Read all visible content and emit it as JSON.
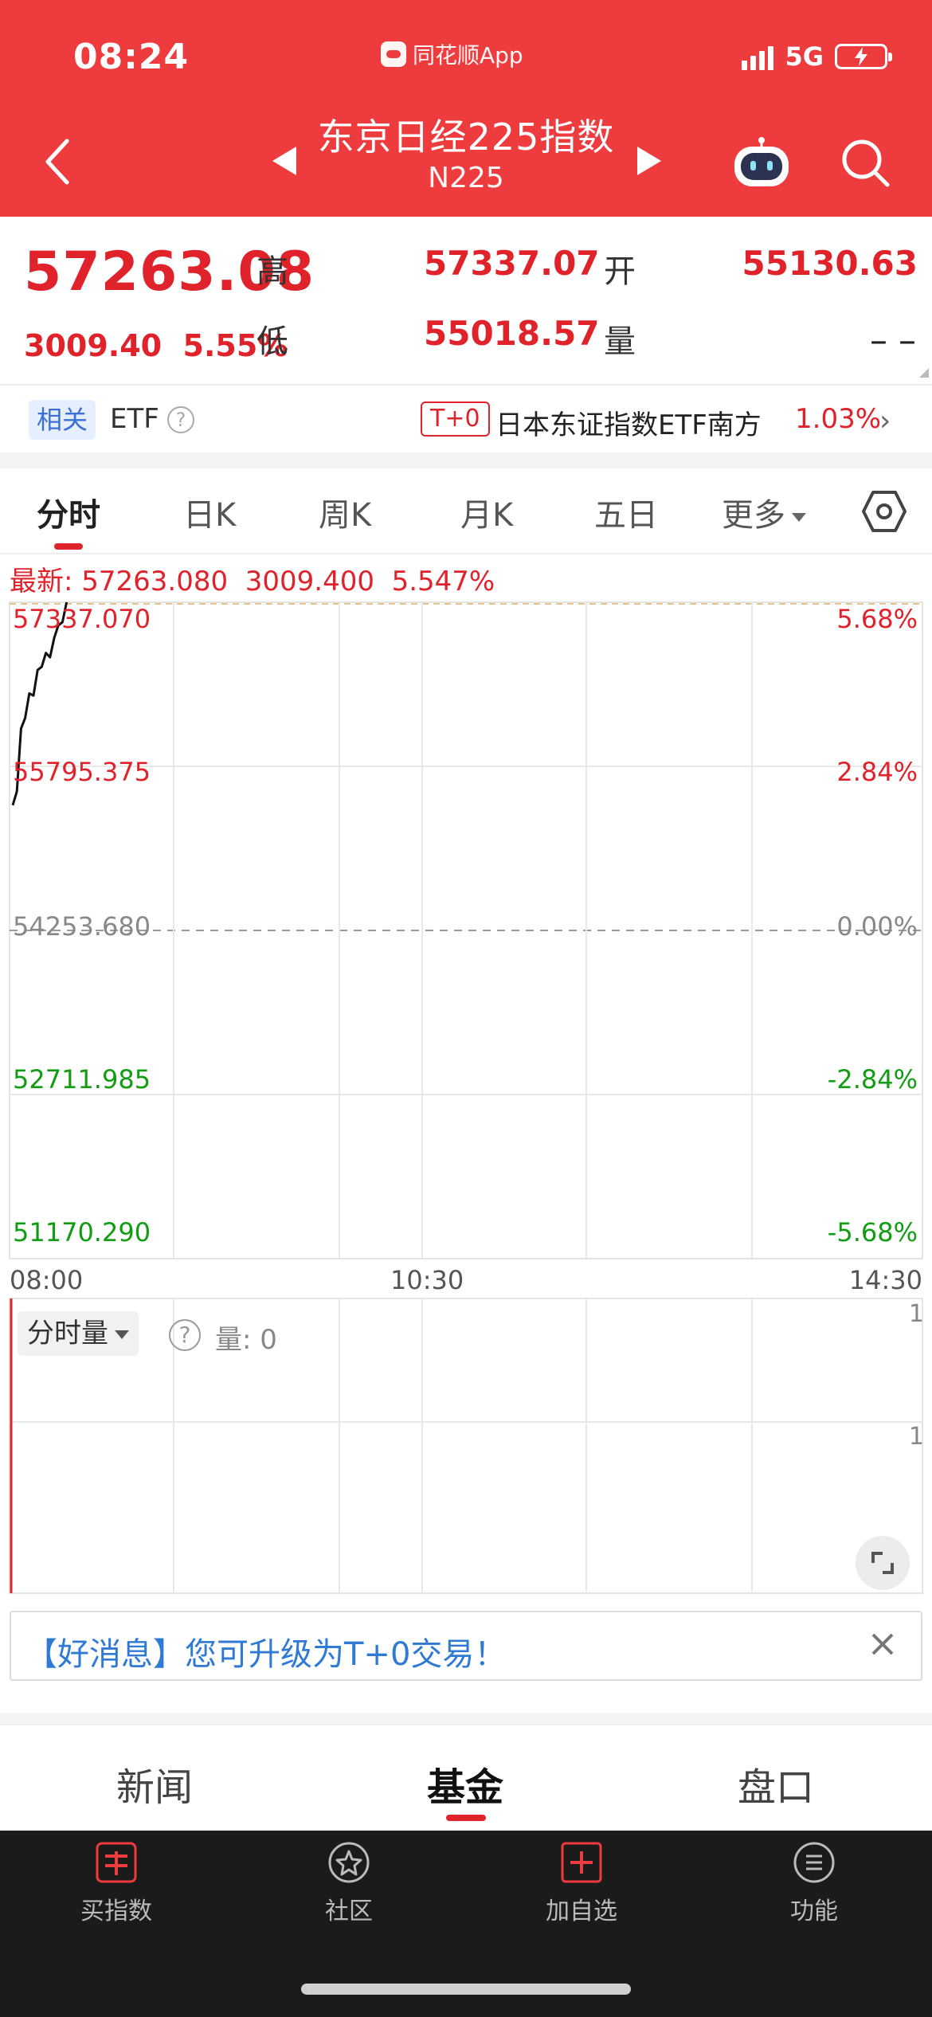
{
  "status_bar": {
    "time": "08:24",
    "app_name": "同花顺App",
    "network": "5G"
  },
  "header": {
    "title": "东京日经225指数",
    "code": "N225"
  },
  "quote": {
    "price": "57263.08",
    "change": "3009.40",
    "change_pct": "5.55%",
    "high_label": "高",
    "high": "57337.07",
    "low_label": "低",
    "low": "55018.57",
    "open_label": "开",
    "open": "55130.63",
    "volume_label": "量",
    "volume": "– –"
  },
  "related": {
    "tag": "相关",
    "label": "ETF",
    "help": "?",
    "t0_tag": "T+0",
    "etf_name": "日本东证指数ETF南方",
    "etf_pct": "1.03%"
  },
  "tabs": {
    "items": [
      "分时",
      "日K",
      "周K",
      "月K",
      "五日",
      "更多"
    ],
    "active": "分时"
  },
  "latest_line": "最新: 57263.080  3009.400  5.547%",
  "chart_data": {
    "type": "line",
    "y_left_labels": [
      "57337.070",
      "55795.375",
      "54253.680",
      "52711.985",
      "51170.290"
    ],
    "y_right_labels": [
      "5.68%",
      "2.84%",
      "0.00%",
      "-2.84%",
      "-5.68%"
    ],
    "x_labels": [
      "08:00",
      "10:30",
      "14:30"
    ],
    "ylim": [
      51170.29,
      57337.07
    ],
    "baseline": 54253.68,
    "series": [
      {
        "values": [
          55430,
          55560,
          56150,
          56250,
          56480,
          56460,
          56700,
          56730,
          56860,
          56820,
          57000,
          57120,
          57150,
          57337
        ]
      }
    ]
  },
  "volume": {
    "selector": "分时量",
    "help": "?",
    "label": "量: 0",
    "y_top": "1",
    "y_mid": "1"
  },
  "promo": {
    "text": "【好消息】您可升级为T+0交易！"
  },
  "bottom_tabs": {
    "items": [
      "新闻",
      "基金",
      "盘口"
    ],
    "active": "基金"
  },
  "nav": {
    "buy": "买指数",
    "community": "社区",
    "add": "加自选",
    "function": "功能"
  }
}
